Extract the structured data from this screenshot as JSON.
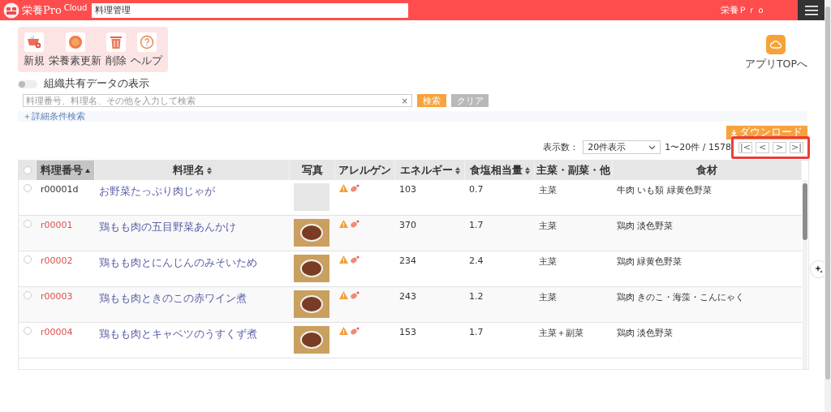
{
  "header": {
    "logo_text": "栄養Pro",
    "logo_sup": "Cloud",
    "page_field": "料理管理",
    "app_name": "栄養Ｐｒｏ"
  },
  "toolbar": [
    {
      "label": "新規",
      "kind": "new"
    },
    {
      "label": "栄養素更新",
      "kind": "update"
    },
    {
      "label": "削除",
      "kind": "delete"
    },
    {
      "label": "ヘルプ",
      "kind": "help"
    }
  ],
  "app_top": {
    "label": "アプリTOPへ"
  },
  "shared_toggle": {
    "label": "組織共有データの表示",
    "on": false
  },
  "search": {
    "placeholder": "料理番号、料理名、その他を入力して検索",
    "clear_icon": "×",
    "search_button": "検索",
    "clear_button": "クリア"
  },
  "advanced_search": "＋詳細条件検索",
  "download_button": "ダウンロード",
  "pagination": {
    "per_page_label": "表示数：",
    "per_page_value": "20件表示",
    "range": "1〜20件 / 1578",
    "buttons": [
      "|<",
      "<",
      ">",
      ">|"
    ]
  },
  "table": {
    "all_selected": false,
    "columns": [
      {
        "label": "料理番号",
        "sortable": true,
        "sorted": true
      },
      {
        "label": "料理名",
        "sortable": true,
        "sorted": false
      },
      {
        "label": "写真",
        "sortable": false,
        "sorted": false
      },
      {
        "label": "アレルゲン",
        "sortable": false,
        "sorted": false
      },
      {
        "label": "エネルギー",
        "sortable": true,
        "sorted": false
      },
      {
        "label": "食塩相当量",
        "sortable": true,
        "sorted": false
      },
      {
        "label": "主菜・副菜・他",
        "sortable": false,
        "sorted": false
      },
      {
        "label": "食材",
        "sortable": false,
        "sorted": false
      }
    ],
    "rows": [
      {
        "selected": false,
        "number": "r00001d",
        "kind": "custom",
        "name": "お野菜たっぷり肉じゃが",
        "photo": false,
        "energy": "103",
        "salt": "0.7",
        "category": "主菜",
        "ingredients": "牛肉 いも類 緑黄色野菜"
      },
      {
        "selected": false,
        "number": "r00001",
        "kind": "standard",
        "name": "鶏もも肉の五目野菜あんかけ",
        "photo": true,
        "energy": "370",
        "salt": "1.7",
        "category": "主菜",
        "ingredients": "鶏肉 淡色野菜"
      },
      {
        "selected": false,
        "number": "r00002",
        "kind": "standard",
        "name": "鶏もも肉とにんじんのみそいため",
        "photo": true,
        "energy": "234",
        "salt": "2.4",
        "category": "主菜",
        "ingredients": "鶏肉 緑黄色野菜"
      },
      {
        "selected": false,
        "number": "r00003",
        "kind": "standard",
        "name": "鶏もも肉ときのこの赤ワイン煮",
        "photo": true,
        "energy": "243",
        "salt": "1.2",
        "category": "主菜",
        "ingredients": "鶏肉 きのこ・海藻・こんにゃく"
      },
      {
        "selected": false,
        "number": "r00004",
        "kind": "standard",
        "name": "鶏もも肉とキャベツのうすくず煮",
        "photo": true,
        "energy": "153",
        "salt": "1.7",
        "category": "主菜＋副菜",
        "ingredients": "鶏肉 淡色野菜"
      }
    ]
  }
}
